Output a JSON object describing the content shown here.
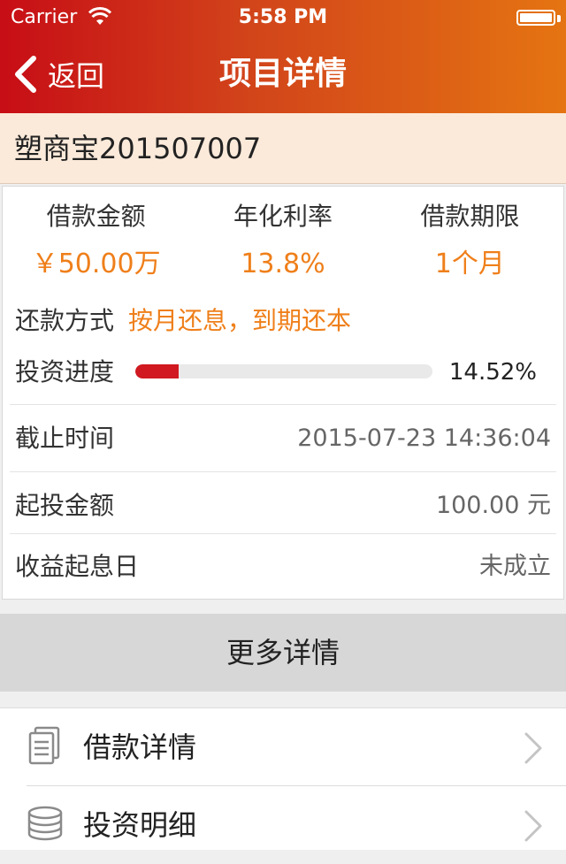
{
  "status_bar": {
    "carrier": "Carrier",
    "time": "5:58 PM"
  },
  "nav": {
    "back_label": "返回",
    "title": "项目详情"
  },
  "project": {
    "name": "塑商宝201507007"
  },
  "stats": [
    {
      "label": "借款金额",
      "value": "￥50.00万"
    },
    {
      "label": "年化利率",
      "value": "13.8%"
    },
    {
      "label": "借款期限",
      "value": "1个月"
    }
  ],
  "repayment": {
    "label": "还款方式",
    "value": "按月还息，到期还本"
  },
  "progress": {
    "label": "投资进度",
    "percent_text": "14.52%",
    "percent": 14.52
  },
  "details": [
    {
      "label": "截止时间",
      "value": "2015-07-23 14:36:04"
    },
    {
      "label": "起投金额",
      "value": "100.00 元"
    },
    {
      "label": "收益起息日",
      "value": "未成立"
    }
  ],
  "more_button": "更多详情",
  "list": [
    {
      "label": "借款详情",
      "icon": "document-icon"
    },
    {
      "label": "投资明细",
      "icon": "coins-icon"
    }
  ],
  "colors": {
    "header_start": "#c70d16",
    "header_end": "#e57412",
    "accent_orange": "#ef7f1a",
    "progress_red": "#d01920"
  }
}
